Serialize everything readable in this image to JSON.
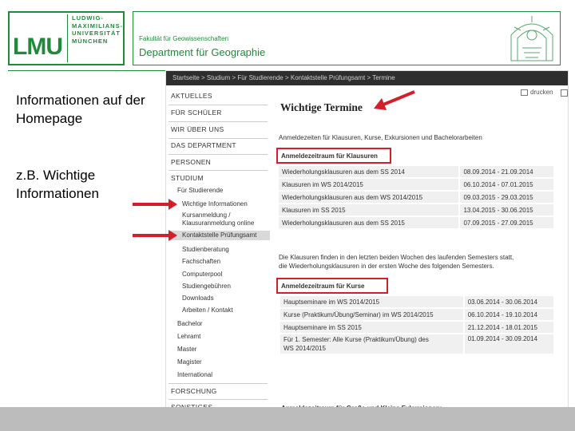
{
  "header": {
    "logo_abbr": "LMU",
    "logo_lines": [
      "LUDWIG-",
      "MAXIMILIANS-",
      "UNIVERSITÄT",
      "MÜNCHEN"
    ],
    "faculty": "Fakultät für Geowissenschaften",
    "department": "Department für Geographie"
  },
  "slide": {
    "text1": "Informationen auf der Homepage",
    "text2": "z.B. Wichtige Informationen"
  },
  "colors": {
    "brand_green": "#1f8a3a",
    "highlight_red": "#d21f2a"
  },
  "website": {
    "breadcrumb": "Startseite > Studium > Für Studierende > Kontaktstelle Prüfungsamt > Termine",
    "print_label": "drucken",
    "nav": [
      "AKTUELLES",
      "FÜR SCHÜLER",
      "WIR ÜBER UNS",
      "DAS DEPARTMENT",
      "PERSONEN",
      "STUDIUM"
    ],
    "studium_sub": "Für Studierende",
    "sub_items": [
      "Wichtige Informationen",
      "Kursanmeldung / Klausuranmeldung online",
      "Kontaktstelle Prüfungsamt",
      "Studienberatung",
      "Fachschaften",
      "Computerpool",
      "Studiengebühren",
      "Downloads",
      "Arbeiten / Kontakt"
    ],
    "programs": [
      "Bachelor",
      "Lehramt",
      "Master",
      "Magister",
      "International"
    ],
    "nav_bottom": [
      "FORSCHUNG",
      "SONSTIGES"
    ],
    "main": {
      "title": "Wichtige Termine",
      "intro": "Anmeldezeiten für Klausuren, Kurse, Exkursionen und Bachelorarbeiten",
      "section1": "Anmeldezeitraum für Klausuren",
      "klausuren": [
        {
          "label": "Wiederholungsklausuren aus dem SS 2014",
          "date": "08.09.2014 - 21.09.2014"
        },
        {
          "label": "Klausuren im WS 2014/2015",
          "date": "06.10.2014 - 07.01.2015"
        },
        {
          "label": "Wiederholungsklausuren aus dem WS 2014/2015",
          "date": "09.03.2015 - 29.03.2015"
        },
        {
          "label": "Klausuren im SS 2015",
          "date": "13.04.2015 - 30.06.2015"
        },
        {
          "label": "Wiederholungsklausuren aus dem SS 2015",
          "date": "07.09.2015 - 27.09.2015"
        }
      ],
      "note_line1": "Die Klausuren finden in den letzten beiden Wochen des laufenden Semesters statt,",
      "note_line2": "die Wiederholungsklausuren in der ersten Woche des folgenden Semesters.",
      "section2": "Anmeldezeitraum für Kurse",
      "kurse": [
        {
          "label": "Hauptseminare im WS 2014/2015",
          "date": "03.06.2014 - 30.06.2014"
        },
        {
          "label": "Kurse (Praktikum/Übung/Seminar) im WS 2014/2015",
          "date": "06.10.2014 - 19.10.2014"
        },
        {
          "label": "Hauptseminare im SS 2015",
          "date": "21.12.2014 - 18.01.2015"
        },
        {
          "label": "Für 1. Semester: Alle Kurse (Praktikum/Übung) des",
          "label2": "WS 2014/2015",
          "date": "01.09.2014 - 30.09.2014"
        }
      ],
      "section3": "Anmeldezeitraum für Große und Kleine Exkursionen:"
    }
  }
}
